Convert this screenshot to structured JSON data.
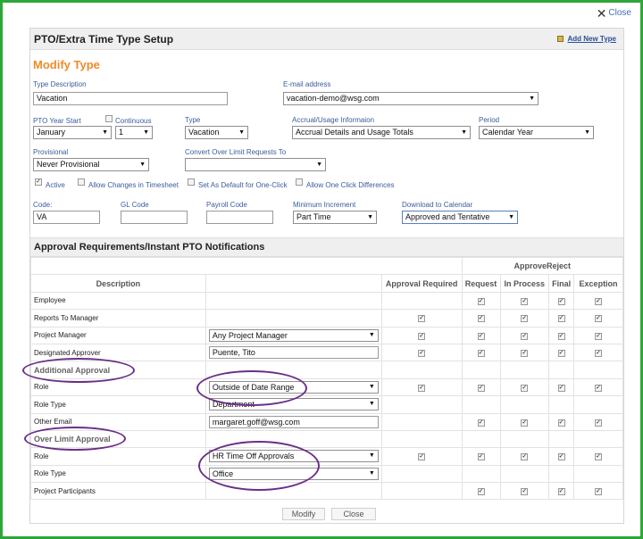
{
  "dialog": {
    "close_label": "Close"
  },
  "panel": {
    "title": "PTO/Extra Time Type Setup",
    "add_new_label": "Add New Type"
  },
  "form": {
    "heading": "Modify Type",
    "type_description": {
      "label": "Type Description",
      "value": "Vacation"
    },
    "email": {
      "label": "E-mail address",
      "value": "vacation-demo@wsg.com"
    },
    "pto_year_start": {
      "label": "PTO Year Start",
      "month": "January",
      "day": "1"
    },
    "continuous": {
      "label": "Continuous"
    },
    "type": {
      "label": "Type",
      "value": "Vacation"
    },
    "accrual": {
      "label": "Accrual/Usage Informaion",
      "value": "Accrual Details and Usage Totals"
    },
    "period": {
      "label": "Period",
      "value": "Calendar Year"
    },
    "provisional": {
      "label": "Provisional",
      "value": "Never Provisional"
    },
    "convert_over_limit": {
      "label": "Convert Over Limit Requests To",
      "value": ""
    },
    "checkboxes": {
      "active": "Active",
      "allow_changes": "Allow Changes in Timesheet",
      "set_default": "Set As Default for One-Click",
      "allow_one_click": "Allow One Click Differences"
    },
    "code": {
      "label": "Code:",
      "value": "VA"
    },
    "gl_code": {
      "label": "GL Code",
      "value": ""
    },
    "payroll_code": {
      "label": "Payroll Code",
      "value": ""
    },
    "min_increment": {
      "label": "Minimum Increment",
      "value": "Part Time"
    },
    "download_calendar": {
      "label": "Download to Calendar",
      "value": "Approved and Tentative"
    }
  },
  "approval": {
    "section_title": "Approval Requirements/Instant PTO Notifications",
    "group_header": "ApproveReject",
    "columns": {
      "description": "Description",
      "approval_required": "Approval Required",
      "request": "Request",
      "in_process": "In Process",
      "final": "Final",
      "exception": "Exception"
    },
    "rows": {
      "employee": "Employee",
      "reports_to": "Reports To Manager",
      "project_manager": {
        "label": "Project Manager",
        "value": "Any Project Manager"
      },
      "designated": {
        "label": "Designated Approver",
        "value": "Puente, Tito"
      },
      "additional_header": "Additional Approval",
      "add_role": {
        "label": "Role",
        "value": "Outside of Date Range"
      },
      "add_role_type": {
        "label": "Role Type",
        "value": "Department"
      },
      "other_email": {
        "label": "Other Email",
        "value": "margaret.goff@wsg.com"
      },
      "over_limit_header": "Over Limit Approval",
      "ol_role": {
        "label": "Role",
        "value": "HR Time Off Approvals"
      },
      "ol_role_type": {
        "label": "Role Type",
        "value": "Office"
      },
      "participants": "Project Participants"
    }
  },
  "buttons": {
    "modify": "Modify",
    "close": "Close"
  },
  "colors": {
    "frame": "#2fa63a",
    "heading": "#f08a2a",
    "label": "#3a5c9c",
    "annotation": "#6b2f86"
  }
}
